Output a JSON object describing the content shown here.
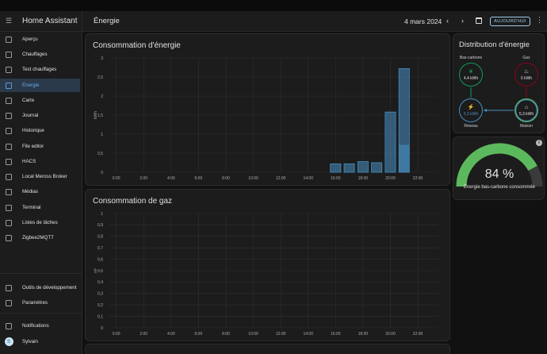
{
  "app": {
    "title": "Home Assistant",
    "user_initial": "S",
    "user_name": "Sylvain"
  },
  "sidebar": {
    "items": [
      {
        "label": "Aperçu",
        "icon": "dashboard-icon"
      },
      {
        "label": "Chauffages",
        "icon": "heat-wave-icon"
      },
      {
        "label": "Test chauffages",
        "icon": "thermometer-icon"
      },
      {
        "label": "Énergie",
        "icon": "lightning-bolt-icon",
        "active": true
      },
      {
        "label": "Carte",
        "icon": "map-icon"
      },
      {
        "label": "Journal",
        "icon": "list-icon"
      },
      {
        "label": "Historique",
        "icon": "chart-box-icon"
      },
      {
        "label": "File editor",
        "icon": "wrench-icon"
      },
      {
        "label": "HACS",
        "icon": "hacs-icon"
      },
      {
        "label": "Local Meross Broker",
        "icon": "broker-icon"
      },
      {
        "label": "Médias",
        "icon": "media-icon"
      },
      {
        "label": "Terminal",
        "icon": "console-icon"
      },
      {
        "label": "Listes de tâches",
        "icon": "clipboard-list-icon"
      },
      {
        "label": "Zigbee2MQTT",
        "icon": "zigbee-icon"
      }
    ],
    "bottom_items": [
      {
        "label": "Outils de développement",
        "icon": "hammer-icon"
      },
      {
        "label": "Paramètres",
        "icon": "cog-icon"
      }
    ],
    "notifications_label": "Notifications"
  },
  "header": {
    "title": "Énergie",
    "date": "4 mars 2024",
    "today_label": "AUJOURD'HUI"
  },
  "energy_card": {
    "title": "Consommation d'énergie"
  },
  "gas_card": {
    "title": "Consommation de gaz"
  },
  "distribution": {
    "title": "Distribution d'énergie",
    "low_carbon": {
      "label": "Bas-carbone",
      "value": "4,4 kWh"
    },
    "gas": {
      "label": "Gaz",
      "value": "0 kWh"
    },
    "grid": {
      "label": "Réseau",
      "value": "5,3 kWh"
    },
    "home": {
      "label": "Maison",
      "value": "5,3 kWh"
    },
    "colors": {
      "low_carbon": "#0f9d58",
      "gas": "#8e021b",
      "grid": "#488fc2",
      "home": "#5cb85c"
    }
  },
  "gauge": {
    "value": 84,
    "percent_text": "84 %",
    "label": "Énergie bas-carbone consommée",
    "color": "#5cb85c"
  },
  "chart_data": [
    {
      "type": "bar",
      "ylabel": "kWh",
      "x_ticks": [
        "0:00",
        "2:00",
        "4:00",
        "6:00",
        "8:00",
        "10:00",
        "12:00",
        "14:00",
        "16:00",
        "18:00",
        "20:00",
        "22:00"
      ],
      "y_ticks": [
        "0",
        "0,5",
        "1",
        "1,5",
        "2",
        "2,5",
        "3"
      ],
      "ylim": [
        0,
        3
      ],
      "hours": [
        16,
        17,
        18,
        19,
        20,
        21
      ],
      "values": [
        0.22,
        0.22,
        0.28,
        0.25,
        1.58,
        2.72
      ],
      "highlight_values": [
        0,
        0,
        0,
        0,
        0,
        0.72
      ],
      "color": "#488fc2"
    },
    {
      "type": "bar",
      "ylabel": "m³",
      "x_ticks": [
        "0:00",
        "2:00",
        "4:00",
        "6:00",
        "8:00",
        "10:00",
        "12:00",
        "14:00",
        "16:00",
        "18:00",
        "20:00",
        "22:00"
      ],
      "y_ticks": [
        "0",
        "0,1",
        "0,2",
        "0,3",
        "0,4",
        "0,5",
        "0,6",
        "0,7",
        "0,8",
        "0,9",
        "1"
      ],
      "ylim": [
        0,
        1
      ],
      "hours": [],
      "values": []
    }
  ]
}
